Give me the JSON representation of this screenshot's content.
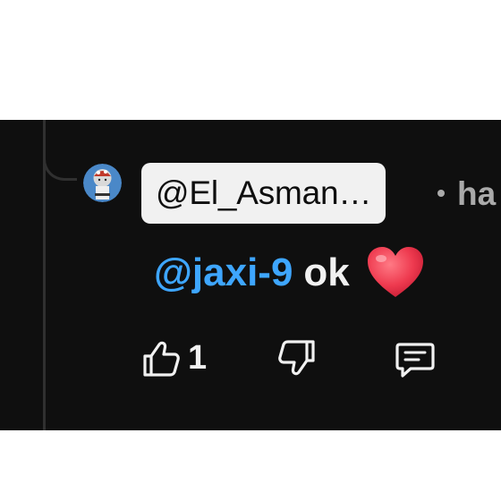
{
  "comment": {
    "author": "@El_Asman…",
    "time_prefix": "ha",
    "mention": "@jaxi-9",
    "text": "ok",
    "emoji": "heart",
    "like_count": "1"
  },
  "colors": {
    "background": "#0f0f0f",
    "mention": "#3ea6ff",
    "text": "#f1f1f1",
    "secondary_text": "#aaaaaa",
    "heart": "#e8354a"
  },
  "icons": {
    "like": "thumbs-up-icon",
    "dislike": "thumbs-down-icon",
    "reply": "comment-icon"
  }
}
